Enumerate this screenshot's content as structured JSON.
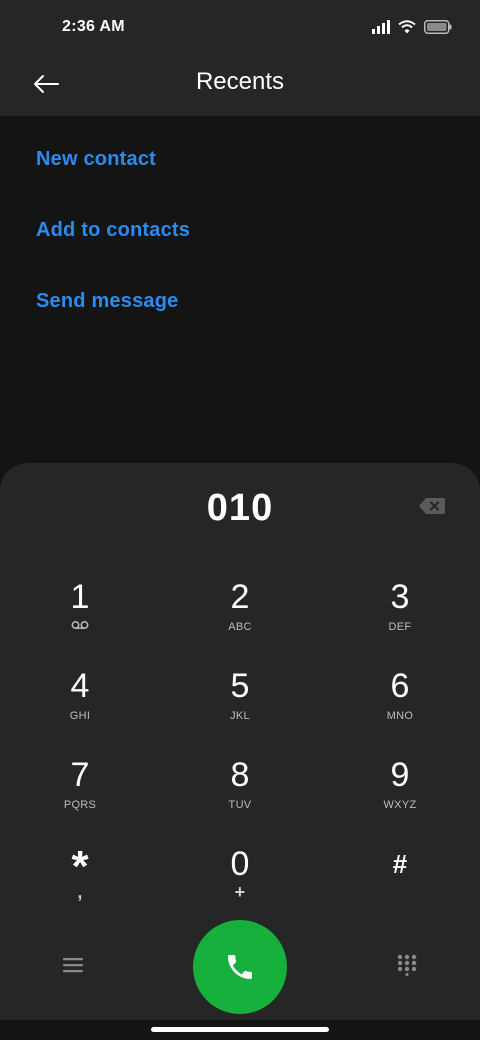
{
  "status": {
    "time": "2:36 AM",
    "icons": [
      "signal-icon",
      "wifi-icon",
      "battery-icon"
    ]
  },
  "appbar": {
    "title": "Recents",
    "back_icon": "back-arrow-icon"
  },
  "actions": [
    {
      "label": "New contact"
    },
    {
      "label": "Add to contacts"
    },
    {
      "label": "Send message"
    }
  ],
  "dialer": {
    "number": "010",
    "keys": [
      {
        "digit": "1",
        "sub": ""
      },
      {
        "digit": "2",
        "sub": "ABC"
      },
      {
        "digit": "3",
        "sub": "DEF"
      },
      {
        "digit": "4",
        "sub": "GHI"
      },
      {
        "digit": "5",
        "sub": "JKL"
      },
      {
        "digit": "6",
        "sub": "MNO"
      },
      {
        "digit": "7",
        "sub": "PQRS"
      },
      {
        "digit": "8",
        "sub": "TUV"
      },
      {
        "digit": "9",
        "sub": "WXYZ"
      },
      {
        "digit": "*",
        "sub": ","
      },
      {
        "digit": "0",
        "sub": "+"
      },
      {
        "digit": "#",
        "sub": ""
      }
    ]
  },
  "colors": {
    "accent": "#2a8cf0",
    "call": "#17b03c",
    "background": "#141414",
    "surface": "#262626"
  }
}
